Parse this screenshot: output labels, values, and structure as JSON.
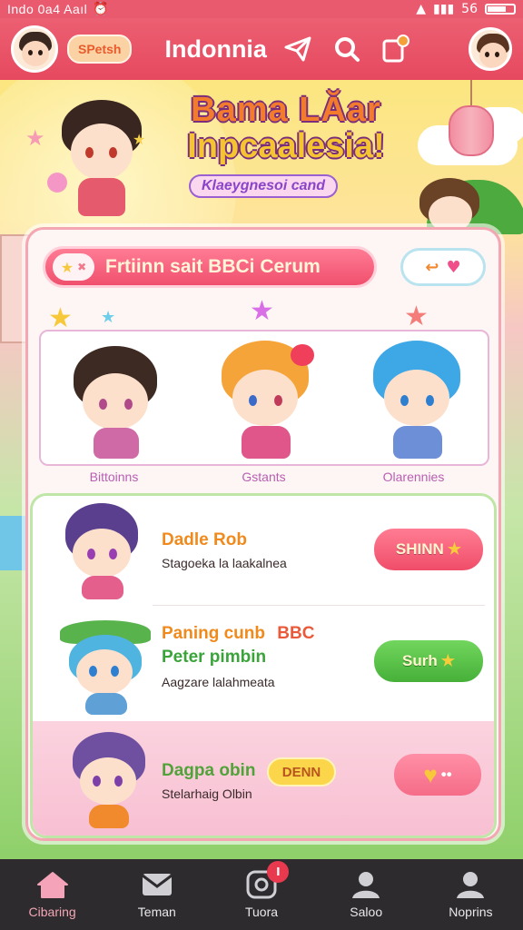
{
  "status_bar": {
    "carrier": "Indo 0a4 Aaıl",
    "battery_text": "56"
  },
  "header": {
    "user_chip": "SPetsh",
    "title": "Indonnia"
  },
  "hero": {
    "title_line1": "Bama LĂar",
    "title_line2": "Inpcaalesia!",
    "subtitle": "Klaeygnesoi cand"
  },
  "search": {
    "label": "Frtiinn sait BBCi Cerum"
  },
  "characters": [
    {
      "label": "Bittoinns"
    },
    {
      "label": "Gstants"
    },
    {
      "label": "Olarennies"
    }
  ],
  "list": [
    {
      "title": "Dadle Rob",
      "subtitle": "Stagoeka la laakalnea",
      "button": "SHINN",
      "title_color": "#f08a1c"
    },
    {
      "title": "Paning cunb",
      "title_extra": "BBC",
      "title2": "Peter pimbin",
      "subtitle": "Aagzare lalahmeata",
      "button": "Surh",
      "title_color": "#f08a1c"
    },
    {
      "title": "Dagpa obin",
      "subtitle": "Stelarhaig Olbin",
      "badge": "DENN",
      "title_color": "#52a23a"
    }
  ],
  "nav": [
    {
      "label": "Cibaring",
      "icon": "home-icon",
      "active": true
    },
    {
      "label": "Teman",
      "icon": "mail-icon",
      "active": false
    },
    {
      "label": "Tuora",
      "icon": "chat-icon",
      "active": false,
      "badge": "I"
    },
    {
      "label": "Saloo",
      "icon": "person-icon",
      "active": false
    },
    {
      "label": "Noprins",
      "icon": "profile-icon",
      "active": false
    }
  ],
  "colors": {
    "primary": "#e94e66",
    "accent_green": "#5bc24a",
    "accent_orange": "#f08a1c"
  }
}
